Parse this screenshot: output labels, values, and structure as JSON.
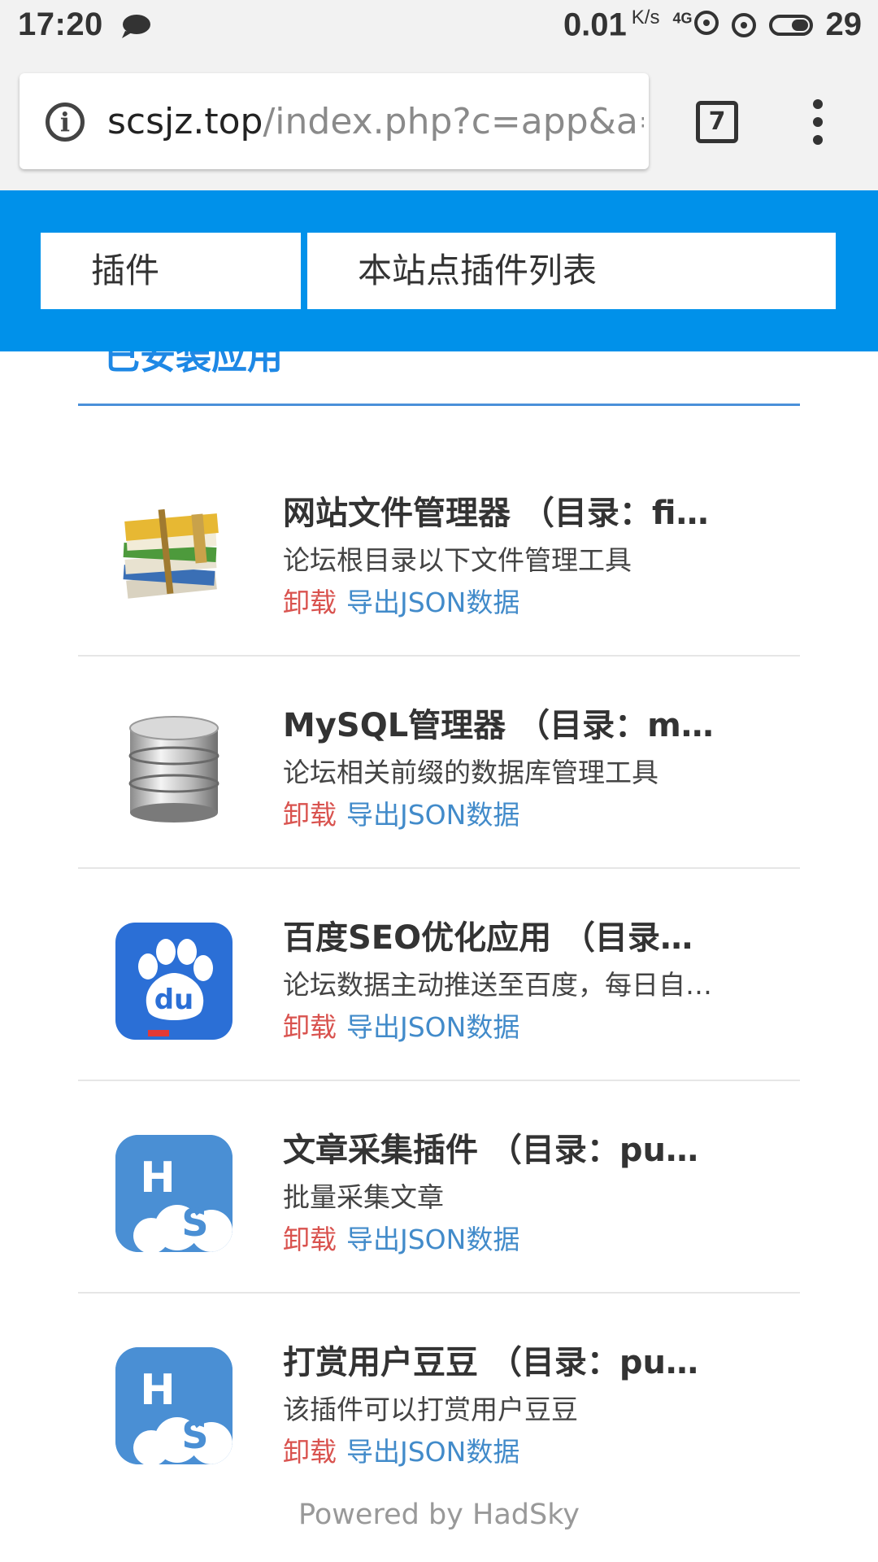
{
  "status_bar": {
    "time": "17:20",
    "speed": "0.01",
    "speed_unit": "K/s",
    "network": "4G",
    "battery": "29"
  },
  "browser": {
    "url_host": "scsjz.top",
    "url_path": "/index.php?c=app&a=",
    "tab_count": "7"
  },
  "header": {
    "crumb_plugins": "插件",
    "crumb_list": "本站点插件列表"
  },
  "section_title_partial": "已安装应用",
  "plugins": [
    {
      "name": "网站文件管理器 （目录：filemanager）",
      "desc": "论坛根目录以下文件管理工具",
      "uninstall": "卸载",
      "export": "导出JSON数据",
      "icon": "file-stack-icon"
    },
    {
      "name": "MySQL管理器 （目录：mysql）",
      "desc": "论坛相关前缀的数据库管理工具",
      "uninstall": "卸载",
      "export": "导出JSON数据",
      "icon": "database-icon"
    },
    {
      "name": "百度SEO优化应用 （目录：baiduseo）",
      "desc": "论坛数据主动推送至百度，每日自动推送",
      "uninstall": "卸载",
      "export": "导出JSON数据",
      "icon": "baidu-icon"
    },
    {
      "name": "文章采集插件 （目录：puyuetian）",
      "desc": "批量采集文章",
      "uninstall": "卸载",
      "export": "导出JSON数据",
      "icon": "hadsky-icon"
    },
    {
      "name": "打赏用户豆豆 （目录：puyuetian）",
      "desc": "该插件可以打赏用户豆豆",
      "uninstall": "卸载",
      "export": "导出JSON数据",
      "icon": "hadsky-icon"
    }
  ],
  "footer": "Powered by HadSky"
}
